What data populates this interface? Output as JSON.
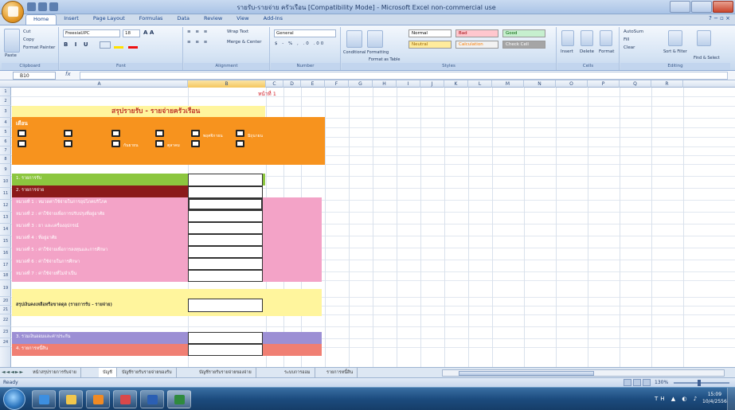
{
  "window": {
    "title": "รายรับ-รายจ่าย ครัวเรือน [Compatibility Mode] - Microsoft Excel non-commercial use"
  },
  "ribbon_tabs": [
    "Home",
    "Insert",
    "Page Layout",
    "Formulas",
    "Data",
    "Review",
    "View",
    "Add-Ins"
  ],
  "ribbon": {
    "clipboard": {
      "label": "Clipboard",
      "paste": "Paste",
      "cut": "Cut",
      "copy": "Copy",
      "format_painter": "Format Painter"
    },
    "font": {
      "label": "Font",
      "font_name": "FreesiaUPC",
      "font_size": "18"
    },
    "alignment": {
      "label": "Alignment",
      "wrap_text": "Wrap Text",
      "merge_center": "Merge & Center"
    },
    "number": {
      "label": "Number",
      "format": "General"
    },
    "styles": {
      "label": "Styles",
      "conditional_formatting": "Conditional Formatting",
      "format_as_table": "Format as Table",
      "cells": [
        {
          "text": "Normal",
          "bg": "#ffffff",
          "fg": "#000000"
        },
        {
          "text": "Bad",
          "bg": "#ffc7ce",
          "fg": "#9c0006"
        },
        {
          "text": "Good",
          "bg": "#c6efce",
          "fg": "#006100"
        },
        {
          "text": "Neutral",
          "bg": "#ffeb9c",
          "fg": "#9c6500"
        },
        {
          "text": "Calculation",
          "bg": "#f2f2f2",
          "fg": "#fa7d00"
        },
        {
          "text": "Check Cell",
          "bg": "#a5a5a5",
          "fg": "#ffffff"
        }
      ]
    },
    "cells_group": {
      "label": "Cells",
      "insert": "Insert",
      "delete": "Delete",
      "format": "Format"
    },
    "editing": {
      "label": "Editing",
      "autosum": "AutoSum",
      "fill": "Fill",
      "clear": "Clear",
      "sort_filter": "Sort & Filter",
      "find_select": "Find & Select"
    }
  },
  "formula_bar": {
    "name_box": "B10",
    "fx": "fx",
    "value": ""
  },
  "columns": [
    "A",
    "B",
    "C",
    "D",
    "E",
    "F",
    "G",
    "H",
    "I",
    "J",
    "K",
    "L",
    "M",
    "N",
    "O",
    "P",
    "Q",
    "R"
  ],
  "rows": [
    "1",
    "2",
    "3",
    "4",
    "5",
    "6",
    "7",
    "8",
    "9",
    "10",
    "11",
    "12",
    "13",
    "14",
    "15",
    "16",
    "17",
    "18",
    "19",
    "20",
    "21",
    "22",
    "23",
    "24"
  ],
  "sheet": {
    "page_label": "หน้าที่ 1",
    "title": "สรุปรายรับ - รายจ่ายครัวเรือน",
    "month_label": "เดือน",
    "checkbox_labels": [
      "กันยายน",
      "ตุลาคม",
      "พฤศจิกายน",
      "มิถุนายน"
    ],
    "income_label": "1. รายการรับ",
    "expense_label": "2. รายการจ่าย",
    "categories": [
      "หมวดที่ 1 : หมวดค่าใช้จ่ายในการอุปโภคบริโภค",
      "หมวดที่ 2 : ค่าใช้จ่ายเพื่อการปรับปรุงที่อยู่อาศัย",
      "หมวดที่ 3 : ยา และเครื่องอุปกรณ์",
      "หมวดที่ 4 : ที่อยู่อาศัย",
      "หมวดที่ 5 : ค่าใช้จ่ายเพื่อการลงทุนและการศึกษา",
      "หมวดที่ 6 : ค่าใช้จ่ายในการศึกษา",
      "หมวดที่ 7 : ค่าใช้จ่ายที่ไม่จำเป็น"
    ],
    "summary_label": "สรุปเงินคงเหลือหรือขาดดุล (รายการรับ - รายจ่าย)",
    "savings_label": "3. รวมเงินออมและค่าประกัน",
    "debt_label": "4. รายการหนี้สิน"
  },
  "sheet_tabs": [
    "หน้าสรุปรายการรับจ่าย",
    "บัญชี",
    "บัญชีรายรับรายจ่ายของรับ",
    "บัญชีรายรับรายจ่ายของจ่าย",
    "ระบบการออม",
    "รายการหนี้สิน"
  ],
  "active_sheet_tab": 1,
  "status": {
    "ready": "Ready",
    "zoom": "130%"
  },
  "clock": {
    "time": "15:09",
    "date": "10/4/2556"
  },
  "colors": {
    "title_band": "#fff59d",
    "month_band": "#f7931e",
    "income_band": "#8cc63f",
    "expense_band": "#8b1a1a",
    "category_band": "#f3a3c7",
    "summary_band": "#fff59d",
    "savings_band": "#9c8fd4",
    "debt_band": "#f07f73"
  }
}
